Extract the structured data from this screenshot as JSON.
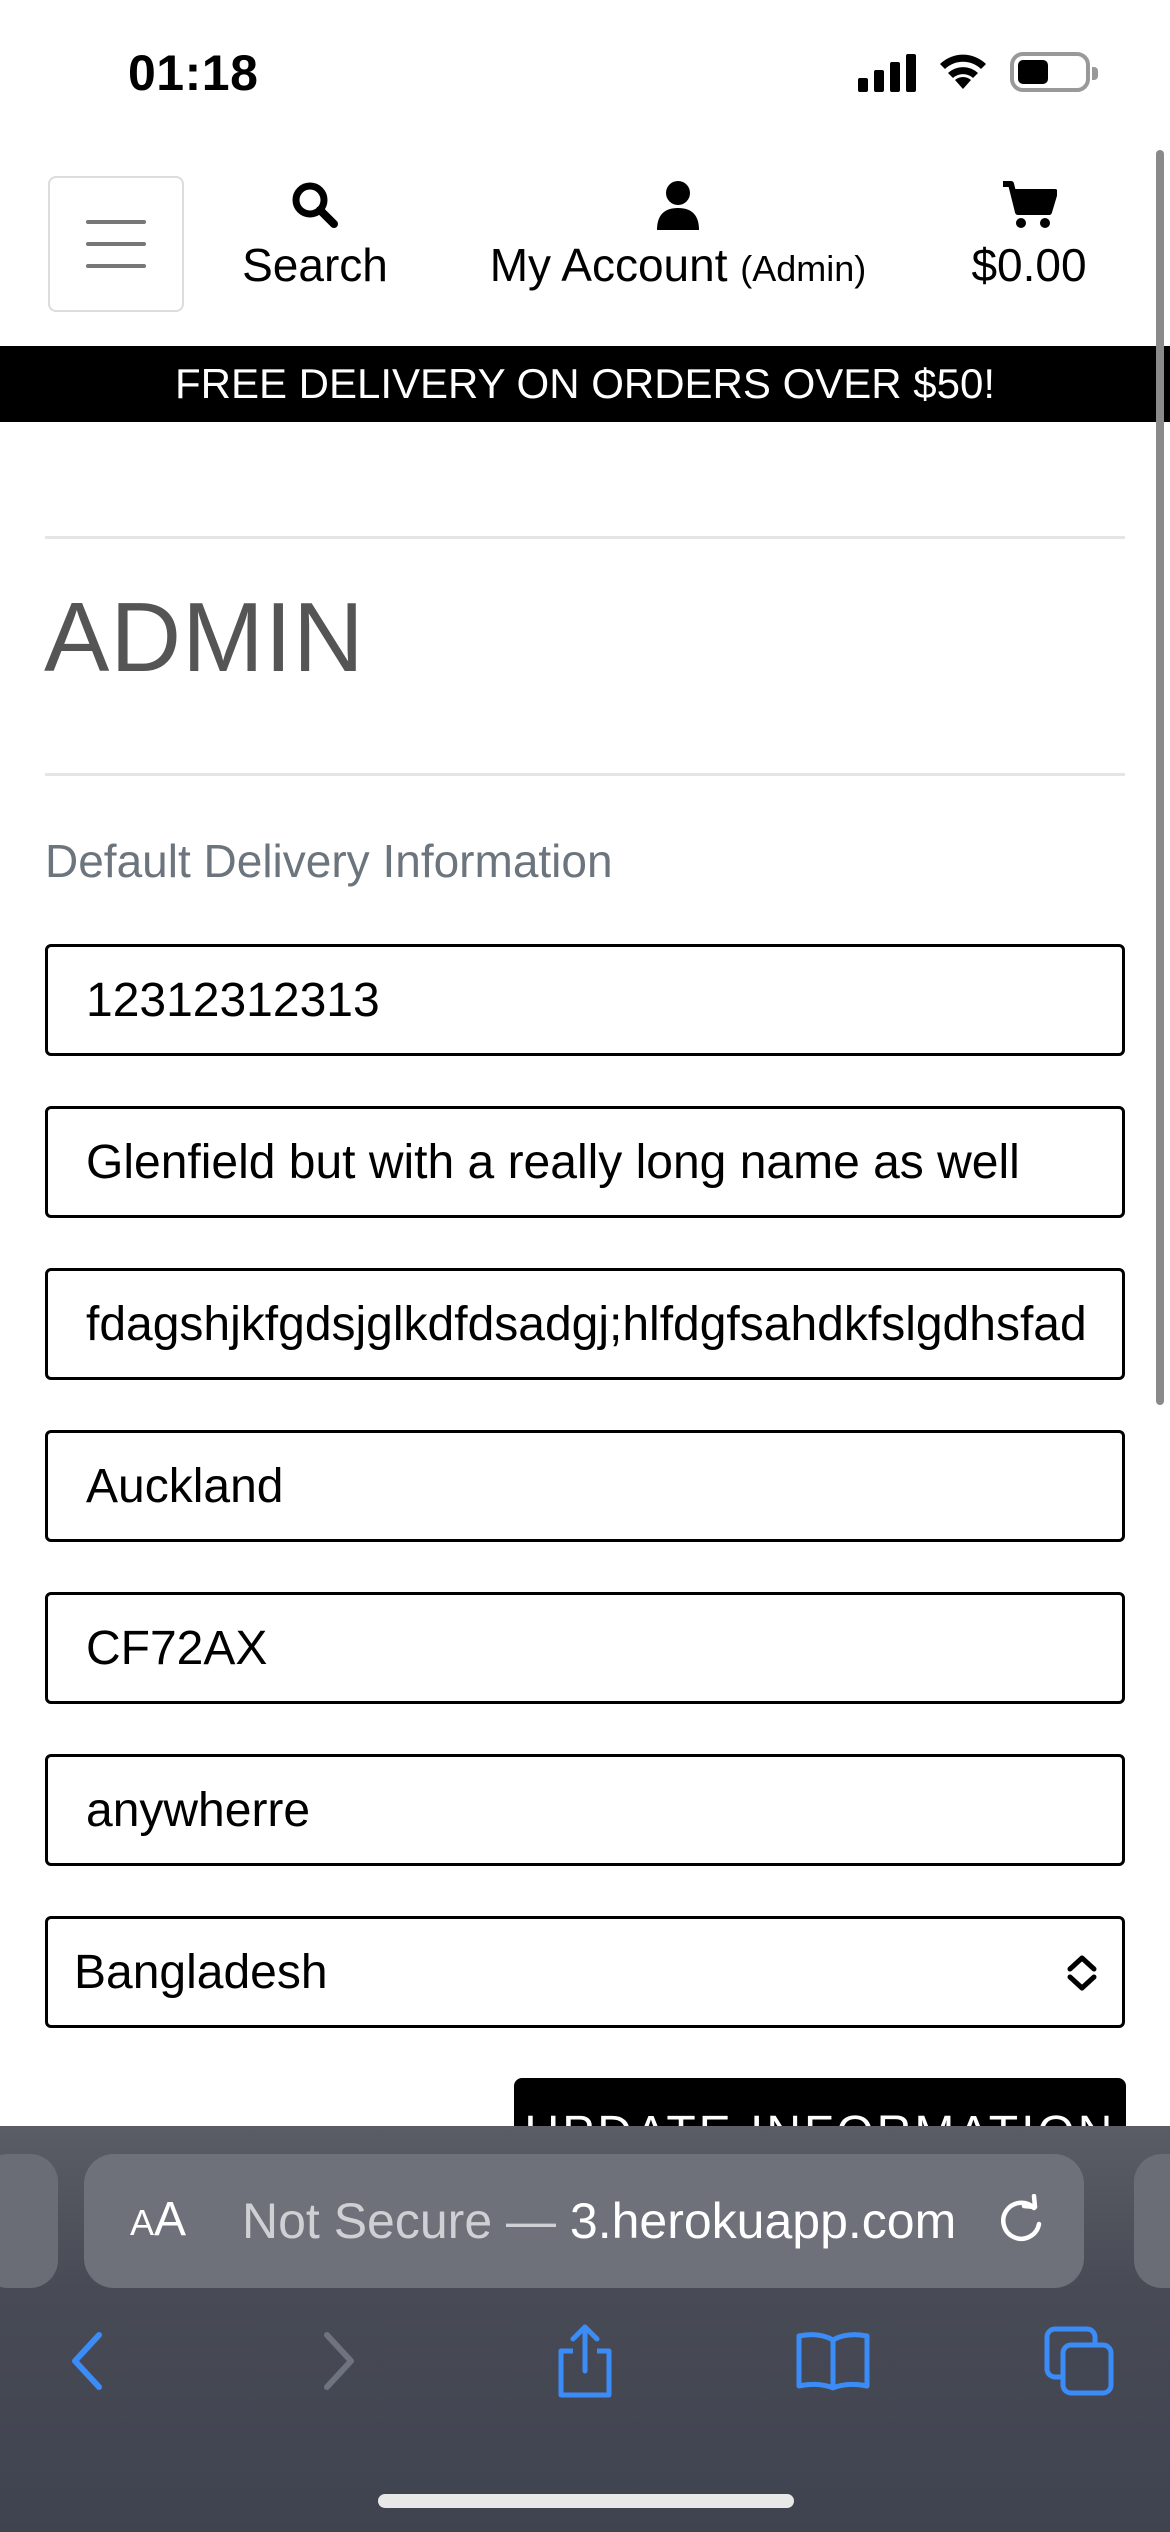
{
  "status_bar": {
    "time": "01:18"
  },
  "header": {
    "search_label": "Search",
    "account_label": "My Account",
    "account_sub": "(Admin)",
    "cart_total": "$0.00"
  },
  "banner": {
    "text": "FREE DELIVERY ON ORDERS OVER $50!"
  },
  "main": {
    "title": "ADMIN",
    "section_label": "Default Delivery Information",
    "fields": {
      "phone": "12312312313",
      "street1": "Glenfield but with a really long name as well",
      "street2": "fdagshjkfgdsjglkdfdsadgj;hlfdgfsahdkfslgdhsfadg",
      "town": "Auckland",
      "postcode": "CF72AX",
      "county": "anywherre"
    },
    "country_selected": "Bangladesh",
    "update_button": "UPDATE INFORMATION"
  },
  "browser": {
    "aa_label_small": "A",
    "aa_label_large": "A",
    "url_prefix": "Not Secure — ",
    "url_domain": "3.herokuapp.com"
  },
  "colors": {
    "banner_bg": "#000000",
    "title_gray": "#555555",
    "label_gray": "#6c757d",
    "safari_icon_blue": "#3b8cf7"
  }
}
